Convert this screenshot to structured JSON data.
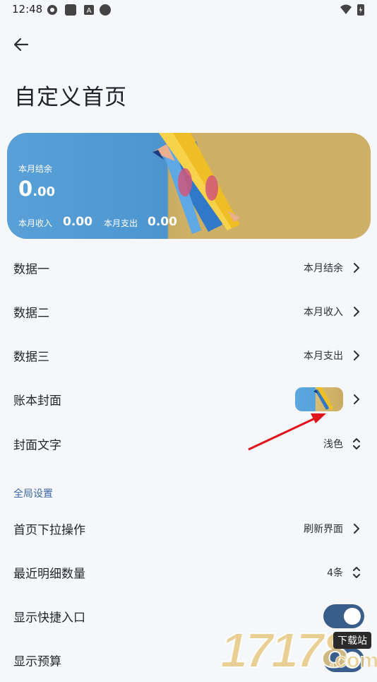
{
  "status_bar": {
    "time": "12:48"
  },
  "header": {
    "title": "自定义首页"
  },
  "cover_card": {
    "balance_label": "本月结余",
    "balance_int": "0",
    "balance_dec": ".00",
    "income_label": "本月收入",
    "income_value": "0.00",
    "expense_label": "本月支出",
    "expense_value": "0.00"
  },
  "settings": {
    "data1": {
      "label": "数据一",
      "value": "本月结余"
    },
    "data2": {
      "label": "数据二",
      "value": "本月收入"
    },
    "data3": {
      "label": "数据三",
      "value": "本月支出"
    },
    "cover": {
      "label": "账本封面"
    },
    "cover_text": {
      "label": "封面文字",
      "value": "浅色"
    }
  },
  "global_section": {
    "header": "全局设置",
    "pull_action": {
      "label": "首页下拉操作",
      "value": "刷新界面"
    },
    "recent_count": {
      "label": "最近明细数量",
      "value": "4条"
    },
    "quick_entry": {
      "label": "显示快捷入口",
      "on": true
    },
    "budget": {
      "label": "显示预算",
      "on": true
    }
  },
  "watermark": {
    "digits": "17178",
    "suffix": ".com",
    "tag": "下载站"
  },
  "colors": {
    "accent": "#3a5e8c",
    "section_header": "#3c67a3",
    "arrow": "#e0141b"
  }
}
